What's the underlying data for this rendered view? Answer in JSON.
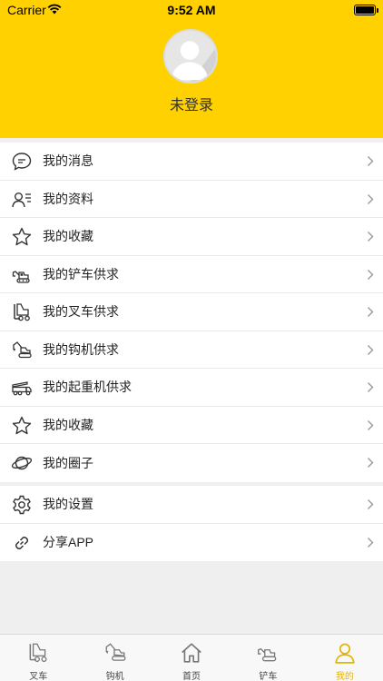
{
  "status_bar": {
    "carrier": "Carrier",
    "time": "9:52 AM"
  },
  "profile": {
    "login_status": "未登录"
  },
  "menu_group_1": [
    {
      "label": "我的消息",
      "icon": "chat-bubble-icon"
    },
    {
      "label": "我的资料",
      "icon": "profile-card-icon"
    },
    {
      "label": "我的收藏",
      "icon": "star-icon"
    },
    {
      "label": "我的铲车供求",
      "icon": "loader-icon"
    },
    {
      "label": "我的叉车供求",
      "icon": "forklift-icon"
    },
    {
      "label": "我的钩机供求",
      "icon": "excavator-icon"
    },
    {
      "label": "我的起重机供求",
      "icon": "crane-truck-icon"
    },
    {
      "label": "我的收藏",
      "icon": "star-icon"
    },
    {
      "label": "我的圈子",
      "icon": "planet-icon"
    }
  ],
  "menu_group_2": [
    {
      "label": "我的设置",
      "icon": "gear-icon"
    },
    {
      "label": "分享APP",
      "icon": "link-icon"
    }
  ],
  "tabbar": [
    {
      "label": "叉车",
      "icon": "forklift-icon"
    },
    {
      "label": "钩机",
      "icon": "excavator-icon"
    },
    {
      "label": "首页",
      "icon": "home-icon"
    },
    {
      "label": "铲车",
      "icon": "loader-icon"
    },
    {
      "label": "我的",
      "icon": "person-icon",
      "active": true
    }
  ],
  "colors": {
    "brand_yellow": "#ffd100",
    "active_tab": "#e6b400"
  }
}
